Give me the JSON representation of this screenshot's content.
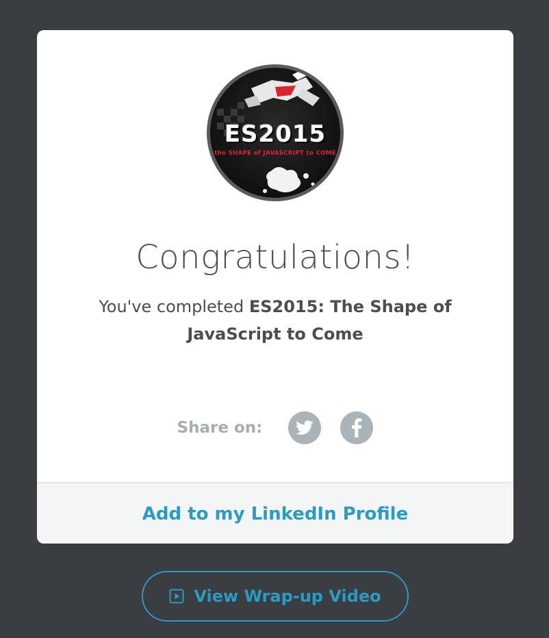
{
  "badge": {
    "logo_text": "ES2015",
    "tagline": "the SHAPE of JAVASCRIPT to COME",
    "image_name": "course-badge"
  },
  "message": {
    "title": "Congratulations!",
    "completed_prefix": "You've completed ",
    "course_name": "ES2015: The Shape of JavaScript to Come"
  },
  "share": {
    "label": "Share on:",
    "networks": [
      {
        "name": "twitter",
        "icon": "twitter-icon"
      },
      {
        "name": "facebook",
        "icon": "facebook-icon"
      }
    ]
  },
  "footer": {
    "linkedin_label": "Add to my LinkedIn Profile"
  },
  "video_button": {
    "label": "View Wrap-up Video",
    "icon": "play-icon"
  },
  "colors": {
    "background": "#3a3d41",
    "card": "#ffffff",
    "accent": "#2a9bc4",
    "muted": "#a6aeb2",
    "text": "#4a4d52"
  }
}
